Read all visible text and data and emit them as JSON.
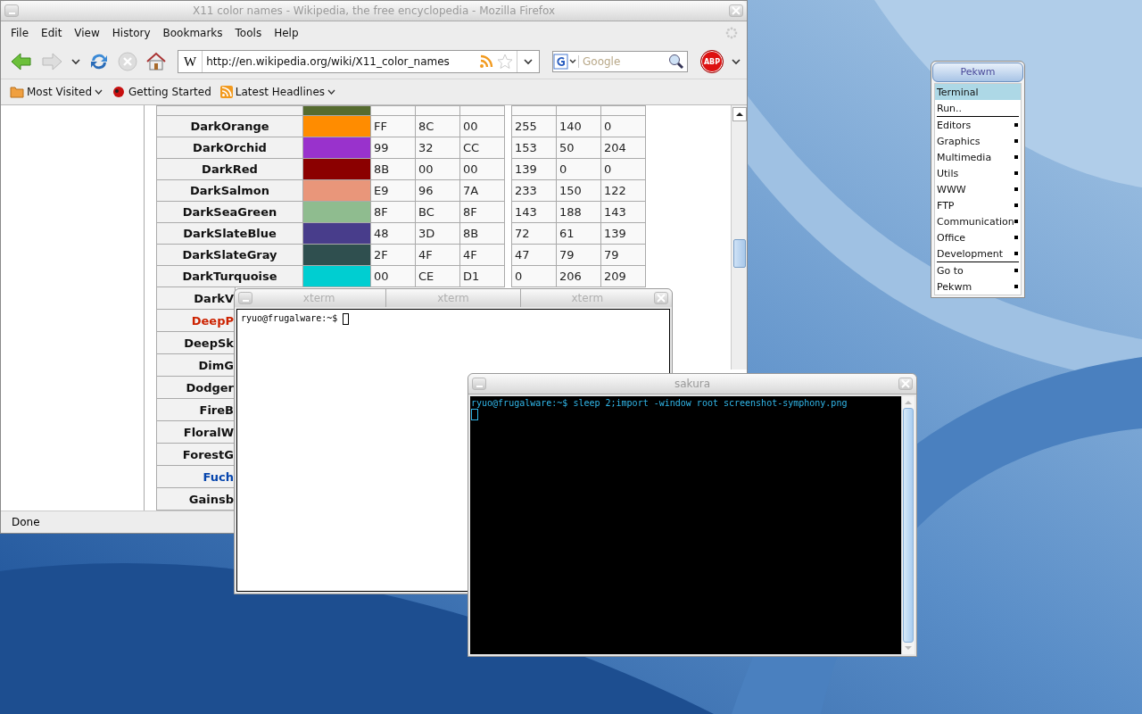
{
  "firefox": {
    "title": "X11 color names - Wikipedia, the free encyclopedia - Mozilla Firefox",
    "menu": [
      "File",
      "Edit",
      "View",
      "History",
      "Bookmarks",
      "Tools",
      "Help"
    ],
    "site_icon": "W",
    "url": "http://en.wikipedia.org/wiki/X11_color_names",
    "search_placeholder": "Google",
    "adblock": "ABP",
    "bookmarks": [
      {
        "label": "Most Visited",
        "kind": "folder",
        "dropdown": true
      },
      {
        "label": "Getting Started",
        "kind": "page",
        "dropdown": false
      },
      {
        "label": "Latest Headlines",
        "kind": "feed",
        "dropdown": true
      }
    ],
    "rows": [
      {
        "kind": "plain",
        "color": "#556b2f"
      },
      {
        "name": "DarkOrange",
        "kind": "plain",
        "color": "#ff8c00",
        "hex": [
          "FF",
          "8C",
          "00"
        ],
        "rgb": [
          "255",
          "140",
          "0"
        ]
      },
      {
        "name": "DarkOrchid",
        "kind": "plain",
        "color": "#9932cc",
        "hex": [
          "99",
          "32",
          "CC"
        ],
        "rgb": [
          "153",
          "50",
          "204"
        ]
      },
      {
        "name": "DarkRed",
        "kind": "plain",
        "color": "#8b0000",
        "hex": [
          "8B",
          "00",
          "00"
        ],
        "rgb": [
          "139",
          "0",
          "0"
        ]
      },
      {
        "name": "DarkSalmon",
        "kind": "plain",
        "color": "#e9967a",
        "hex": [
          "E9",
          "96",
          "7A"
        ],
        "rgb": [
          "233",
          "150",
          "122"
        ]
      },
      {
        "name": "DarkSeaGreen",
        "kind": "plain",
        "color": "#8fbc8f",
        "hex": [
          "8F",
          "BC",
          "8F"
        ],
        "rgb": [
          "143",
          "188",
          "143"
        ]
      },
      {
        "name": "DarkSlateBlue",
        "kind": "plain",
        "color": "#483d8b",
        "hex": [
          "48",
          "3D",
          "8B"
        ],
        "rgb": [
          "72",
          "61",
          "139"
        ]
      },
      {
        "name": "DarkSlateGray",
        "kind": "plain",
        "color": "#2f4f4f",
        "hex": [
          "2F",
          "4F",
          "4F"
        ],
        "rgb": [
          "47",
          "79",
          "79"
        ]
      },
      {
        "name": "DarkTurquoise",
        "kind": "plain",
        "color": "#00ced1",
        "hex": [
          "00",
          "CE",
          "D1"
        ],
        "rgb": [
          "0",
          "206",
          "209"
        ]
      },
      {
        "name": "DarkV",
        "kind": "plain"
      },
      {
        "name": "DeepP",
        "kind": "redlink"
      },
      {
        "name": "DeepSk",
        "kind": "plain"
      },
      {
        "name": "DimG",
        "kind": "plain"
      },
      {
        "name": "Dodger",
        "kind": "plain"
      },
      {
        "name": "FireB",
        "kind": "plain"
      },
      {
        "name": "FloralW",
        "kind": "plain"
      },
      {
        "name": "ForestG",
        "kind": "plain"
      },
      {
        "name": "Fuch",
        "kind": "link"
      },
      {
        "name": "Gainsb",
        "kind": "plain"
      }
    ],
    "status": "Done"
  },
  "xterm": {
    "tabs": [
      "xterm",
      "xterm",
      "xterm"
    ],
    "prompt": "ryuo@frugalware:~$"
  },
  "sakura": {
    "title": "sakura",
    "line": "ryuo@frugalware:~$ sleep 2;import -window root screenshot-symphony.png"
  },
  "menu": {
    "title": "Pekwm",
    "items": [
      {
        "label": "Terminal",
        "kind": "entry",
        "submenu": false,
        "selected": true
      },
      {
        "label": "Run..",
        "kind": "entry",
        "submenu": false,
        "selected": false
      },
      {
        "kind": "separator"
      },
      {
        "label": "Editors",
        "kind": "entry",
        "submenu": true,
        "selected": false
      },
      {
        "label": "Graphics",
        "kind": "entry",
        "submenu": true,
        "selected": false
      },
      {
        "label": "Multimedia",
        "kind": "entry",
        "submenu": true,
        "selected": false
      },
      {
        "label": "Utils",
        "kind": "entry",
        "submenu": true,
        "selected": false
      },
      {
        "label": "WWW",
        "kind": "entry",
        "submenu": true,
        "selected": false
      },
      {
        "label": "FTP",
        "kind": "entry",
        "submenu": true,
        "selected": false
      },
      {
        "label": "Communication",
        "kind": "entry",
        "submenu": true,
        "selected": false
      },
      {
        "label": "Office",
        "kind": "entry",
        "submenu": true,
        "selected": false
      },
      {
        "label": "Development",
        "kind": "entry",
        "submenu": true,
        "selected": false
      },
      {
        "kind": "separator"
      },
      {
        "label": "Go to",
        "kind": "entry",
        "submenu": true,
        "selected": false
      },
      {
        "label": "Pekwm",
        "kind": "entry",
        "submenu": true,
        "selected": false
      }
    ]
  }
}
